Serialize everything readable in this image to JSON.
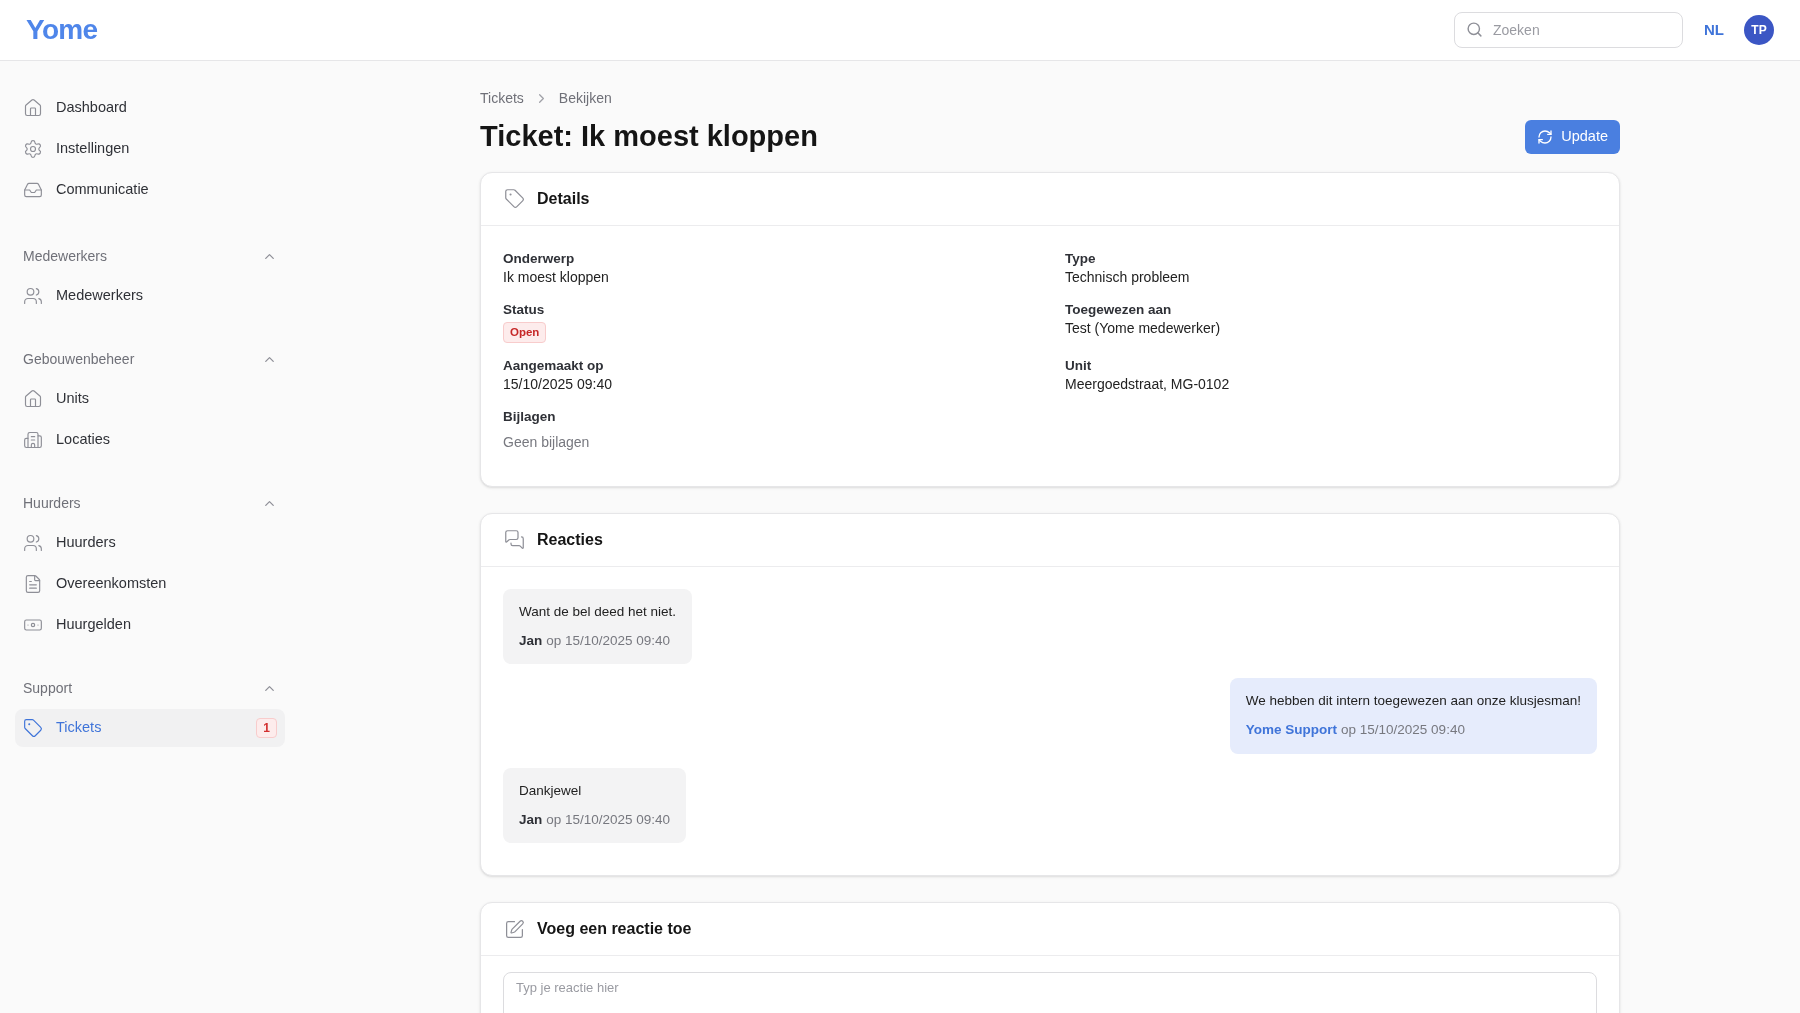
{
  "header": {
    "logo": "Yome",
    "search": {
      "placeholder": "Zoeken"
    },
    "language": "NL",
    "avatar": "TP"
  },
  "sidebar": {
    "items": [
      {
        "label": "Dashboard",
        "kind": "home",
        "selected": false
      },
      {
        "label": "Instellingen",
        "kind": "settings",
        "selected": false
      },
      {
        "label": "Communicatie",
        "kind": "inbox",
        "selected": false
      }
    ],
    "sections": [
      {
        "title": "Medewerkers",
        "expanded": true,
        "items": [
          {
            "label": "Medewerkers",
            "kind": "users",
            "selected": false
          }
        ]
      },
      {
        "title": "Gebouwenbeheer",
        "expanded": true,
        "items": [
          {
            "label": "Units",
            "kind": "home",
            "selected": false
          },
          {
            "label": "Locaties",
            "kind": "building",
            "selected": false
          }
        ]
      },
      {
        "title": "Huurders",
        "expanded": true,
        "items": [
          {
            "label": "Huurders",
            "kind": "users",
            "selected": false
          },
          {
            "label": "Overeenkomsten",
            "kind": "file",
            "selected": false
          },
          {
            "label": "Huurgelden",
            "kind": "money",
            "selected": false
          }
        ]
      },
      {
        "title": "Support",
        "expanded": true,
        "items": [
          {
            "label": "Tickets",
            "kind": "tag",
            "selected": true,
            "badge": "1"
          }
        ]
      }
    ]
  },
  "breadcrumb": [
    "Tickets",
    "Bekijken"
  ],
  "title": "Ticket: Ik moest kloppen",
  "update_button": "Update",
  "details": {
    "title": "Details",
    "fields": [
      {
        "label": "Onderwerp",
        "value": "Ik moest kloppen",
        "kind": "text"
      },
      {
        "label": "Type",
        "value": "Technisch probleem",
        "kind": "text"
      },
      {
        "label": "Status",
        "value": "Open",
        "kind": "badge"
      },
      {
        "label": "Toegewezen aan",
        "value": "Test (Yome medewerker)",
        "kind": "text"
      },
      {
        "label": "Aangemaakt op",
        "value": "15/10/2025 09:40",
        "kind": "text"
      },
      {
        "label": "Unit",
        "value": "Meergoedstraat, MG-0102",
        "kind": "text"
      },
      {
        "label": "Bijlagen",
        "value": "Geen bijlagen",
        "kind": "muted"
      }
    ]
  },
  "reactions": {
    "title": "Reacties",
    "items": [
      {
        "text": "Want de bel deed het niet.",
        "author": "Jan",
        "date": "op 15/10/2025 09:40",
        "own": false
      },
      {
        "text": "We hebben dit intern toegewezen aan onze klusjesman!",
        "author": "Yome Support",
        "date": "op 15/10/2025 09:40",
        "own": true
      },
      {
        "text": "Dankjewel",
        "author": "Jan",
        "date": "op 15/10/2025 09:40",
        "own": false
      }
    ]
  },
  "add_reaction": {
    "title": "Voeg een reactie toe",
    "placeholder": "Typ je reactie hier"
  }
}
